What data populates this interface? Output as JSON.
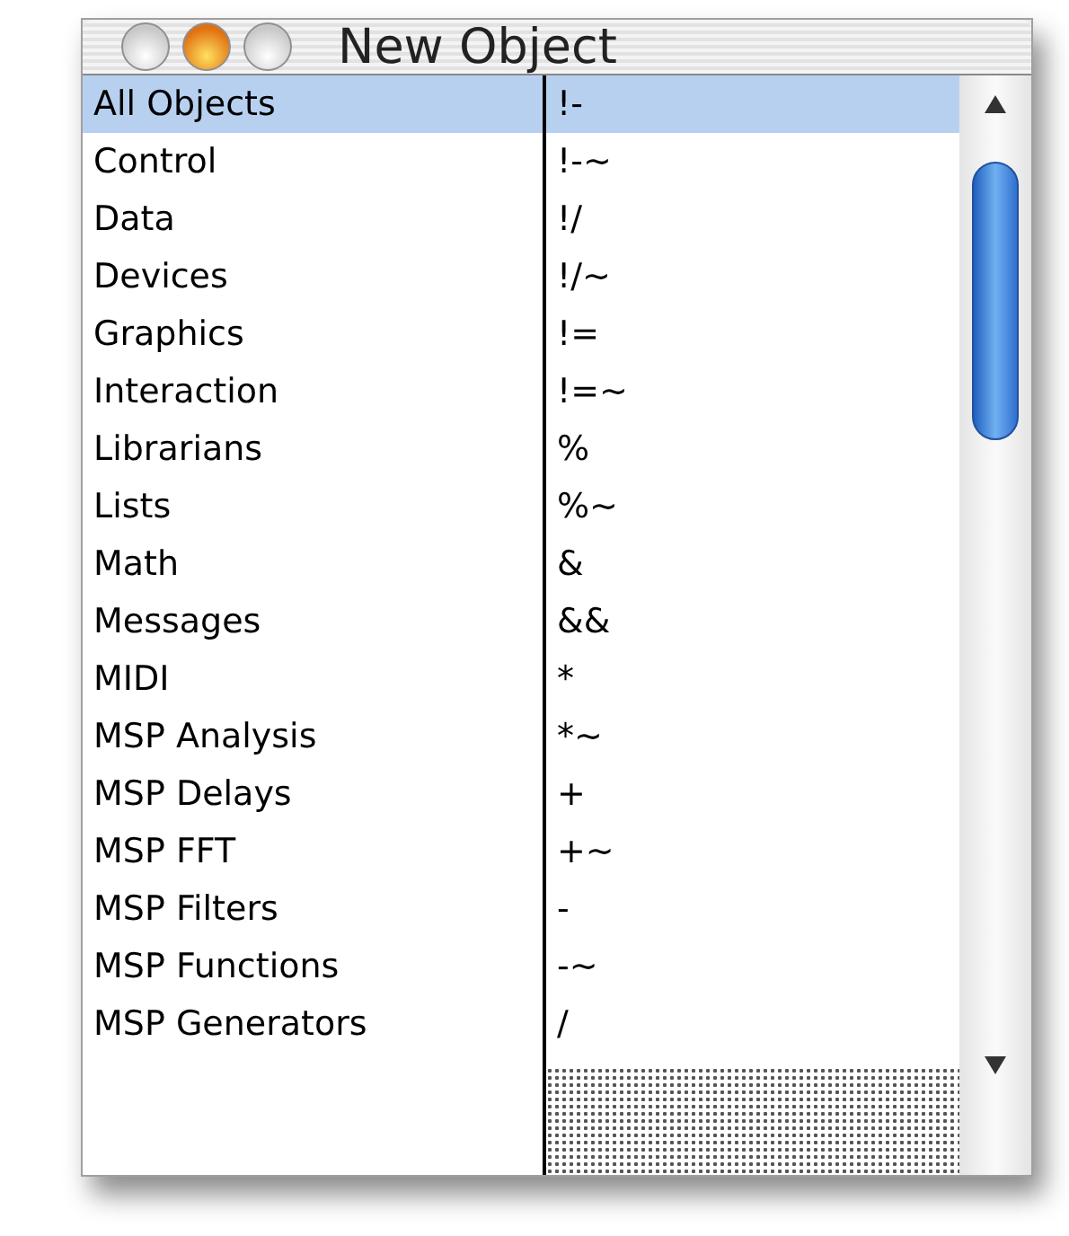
{
  "window": {
    "title": "New Object"
  },
  "categories": [
    {
      "label": "All Objects",
      "selected": true
    },
    {
      "label": "Control",
      "selected": false
    },
    {
      "label": "Data",
      "selected": false
    },
    {
      "label": "Devices",
      "selected": false
    },
    {
      "label": "Graphics",
      "selected": false
    },
    {
      "label": "Interaction",
      "selected": false
    },
    {
      "label": "Librarians",
      "selected": false
    },
    {
      "label": "Lists",
      "selected": false
    },
    {
      "label": "Math",
      "selected": false
    },
    {
      "label": "Messages",
      "selected": false
    },
    {
      "label": "MIDI",
      "selected": false
    },
    {
      "label": "MSP Analysis",
      "selected": false
    },
    {
      "label": "MSP Delays",
      "selected": false
    },
    {
      "label": "MSP FFT",
      "selected": false
    },
    {
      "label": "MSP Filters",
      "selected": false
    },
    {
      "label": "MSP Functions",
      "selected": false
    },
    {
      "label": "MSP Generators",
      "selected": false
    }
  ],
  "objects": [
    {
      "label": "!-",
      "selected": true
    },
    {
      "label": "!-~",
      "selected": false
    },
    {
      "label": "!/",
      "selected": false
    },
    {
      "label": "!/~",
      "selected": false
    },
    {
      "label": "!=",
      "selected": false
    },
    {
      "label": "!=~",
      "selected": false
    },
    {
      "label": "%",
      "selected": false
    },
    {
      "label": "%~",
      "selected": false
    },
    {
      "label": "&",
      "selected": false
    },
    {
      "label": "&&",
      "selected": false
    },
    {
      "label": "*",
      "selected": false
    },
    {
      "label": "*~",
      "selected": false
    },
    {
      "label": "+",
      "selected": false
    },
    {
      "label": "+~",
      "selected": false
    },
    {
      "label": "-",
      "selected": false
    },
    {
      "label": "-~",
      "selected": false
    },
    {
      "label": "/",
      "selected": false
    }
  ]
}
